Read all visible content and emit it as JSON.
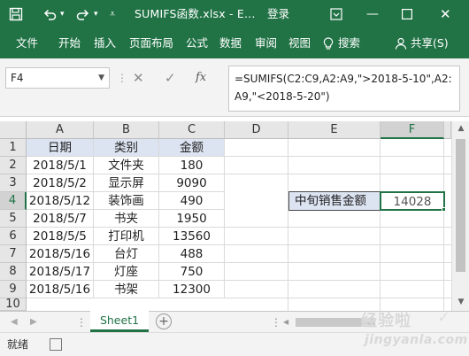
{
  "titlebar": {
    "title": "SUMIFS函数.xlsx  -  E...",
    "login": "登录"
  },
  "ribbon": {
    "tabs": [
      "文件",
      "开始",
      "插入",
      "页面布局",
      "公式",
      "数据",
      "审阅",
      "视图"
    ],
    "search_label": "搜索",
    "share_label": "共享(S)"
  },
  "formula_bar": {
    "name_box": "F4",
    "fx": "fx",
    "cancel": "✕",
    "confirm": "✓",
    "formula": "=SUMIFS(C2:C9,A2:A9,\">2018-5-10\",A2:A9,\"<2018-5-20\")"
  },
  "grid": {
    "columns": [
      "A",
      "B",
      "C",
      "D",
      "E",
      "F"
    ],
    "rows": [
      "1",
      "2",
      "3",
      "4",
      "5",
      "6",
      "7",
      "8",
      "9",
      "10"
    ],
    "headers": [
      "日期",
      "类别",
      "金额"
    ],
    "data": [
      [
        "2018/5/1",
        "文件夹",
        "180"
      ],
      [
        "2018/5/2",
        "显示屏",
        "9090"
      ],
      [
        "2018/5/12",
        "装饰画",
        "490"
      ],
      [
        "2018/5/7",
        "书夹",
        "1950"
      ],
      [
        "2018/5/5",
        "打印机",
        "13560"
      ],
      [
        "2018/5/16",
        "台灯",
        "488"
      ],
      [
        "2018/5/17",
        "灯座",
        "750"
      ],
      [
        "2018/5/16",
        "书架",
        "12300"
      ]
    ],
    "e4_label": "中旬销售金额",
    "f4_value": "14028",
    "selected_cell": "F4"
  },
  "sheets": {
    "tabs": [
      "Sheet1"
    ],
    "add_label": "+"
  },
  "status": {
    "text": "就绪"
  },
  "watermark": {
    "cn": "经验啦",
    "en": "jingyanla.com"
  },
  "colors": {
    "accent": "#217346",
    "header_fill": "#dce3f1"
  }
}
